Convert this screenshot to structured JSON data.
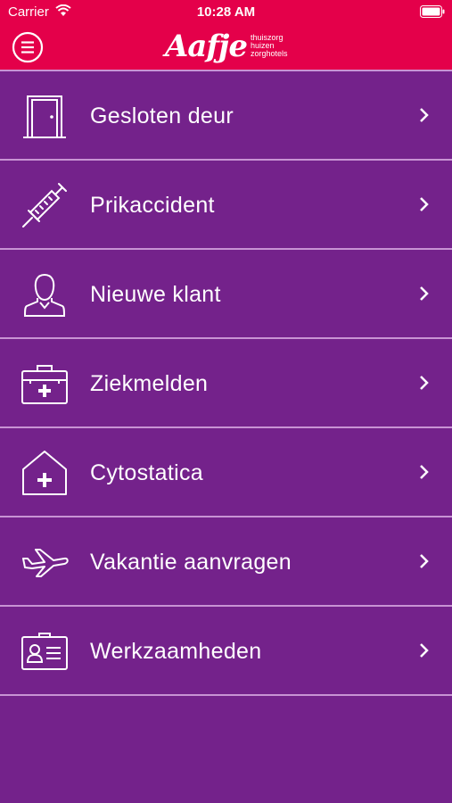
{
  "status_bar": {
    "carrier": "Carrier",
    "time": "10:28 AM"
  },
  "header": {
    "logo_word": "Aafje",
    "logo_sub": [
      "thuiszorg",
      "huizen",
      "zorghotels"
    ],
    "colors": {
      "header_bg": "#e4004a",
      "page_bg": "#74228b",
      "divider": "#c893d4"
    }
  },
  "menu": {
    "items": [
      {
        "label": "Gesloten deur",
        "icon": "door-icon"
      },
      {
        "label": "Prikaccident",
        "icon": "syringe-icon"
      },
      {
        "label": "Nieuwe klant",
        "icon": "person-icon"
      },
      {
        "label": "Ziekmelden",
        "icon": "medical-kit-icon"
      },
      {
        "label": "Cytostatica",
        "icon": "house-plus-icon"
      },
      {
        "label": "Vakantie aanvragen",
        "icon": "airplane-icon"
      },
      {
        "label": "Werkzaamheden",
        "icon": "id-card-icon"
      }
    ]
  }
}
